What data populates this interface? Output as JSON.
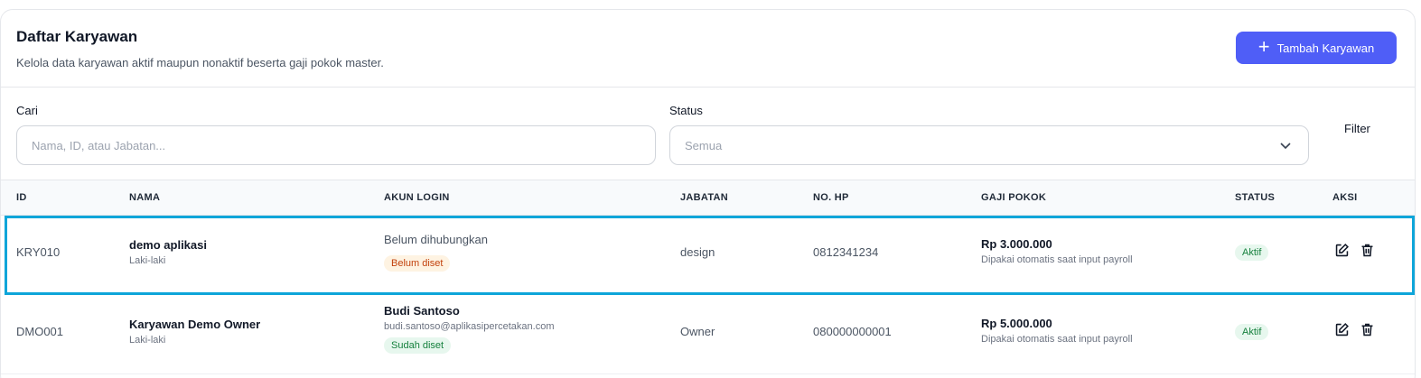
{
  "header": {
    "title": "Daftar Karyawan",
    "subtitle": "Kelola data karyawan aktif maupun nonaktif beserta gaji pokok master.",
    "add_button_label": "Tambah Karyawan"
  },
  "filters": {
    "search_label": "Cari",
    "search_placeholder": "Nama, ID, atau Jabatan...",
    "status_label": "Status",
    "status_value": "Semua",
    "filter_button_label": "Filter"
  },
  "table": {
    "columns": [
      "ID",
      "NAMA",
      "AKUN LOGIN",
      "JABATAN",
      "NO. HP",
      "GAJI POKOK",
      "STATUS",
      "AKSI"
    ],
    "rows": [
      {
        "id": "KRY010",
        "name": "demo aplikasi",
        "gender": "Laki-laki",
        "login_name": "Belum dihubungkan",
        "login_email": "",
        "login_badge": "Belum diset",
        "position": "design",
        "phone": "0812341234",
        "salary": "Rp 3.000.000",
        "salary_note": "Dipakai otomatis saat input payroll",
        "status": "Aktif"
      },
      {
        "id": "DMO001",
        "name": "Karyawan Demo Owner",
        "gender": "Laki-laki",
        "login_name": "Budi Santoso",
        "login_email": "budi.santoso@aplikasipercetakan.com",
        "login_badge": "Sudah diset",
        "position": "Owner",
        "phone": "080000000001",
        "salary": "Rp 5.000.000",
        "salary_note": "Dipakai otomatis saat input payroll",
        "status": "Aktif"
      }
    ]
  },
  "colors": {
    "accent": "#4f5ef7",
    "highlight": "#0ea5d9",
    "status_ok": "#15803d",
    "status_warn": "#c2410c"
  },
  "icons": [
    "plus-icon",
    "chevron-down-icon",
    "edit-icon",
    "trash-icon"
  ]
}
